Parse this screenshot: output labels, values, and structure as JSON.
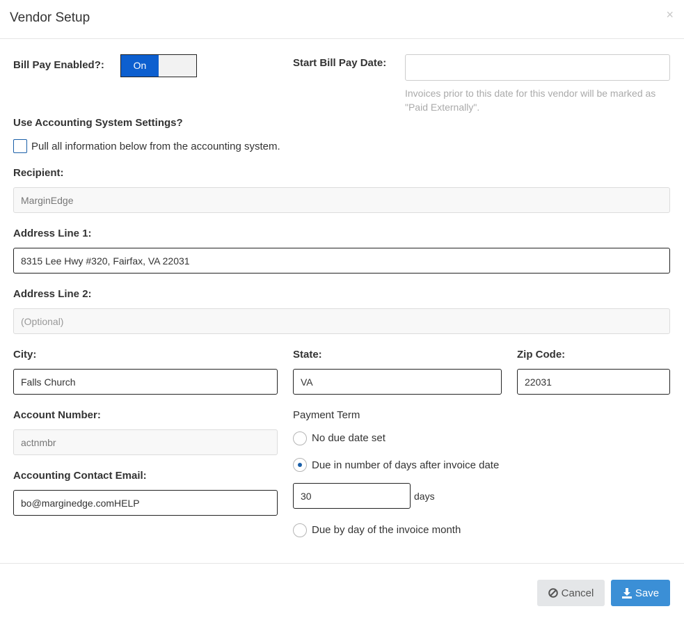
{
  "header": {
    "title": "Vendor Setup",
    "close_glyph": "×"
  },
  "bill_pay": {
    "label": "Bill Pay Enabled?:",
    "toggle_on_label": "On",
    "toggle_state": "on"
  },
  "start_date": {
    "label": "Start Bill Pay Date:",
    "value": "",
    "help": "Invoices prior to this date for this vendor will be marked as \"Paid Externally\"."
  },
  "accounting": {
    "label": "Use Accounting System Settings?",
    "checkbox_label": "Pull all information below from the accounting system.",
    "checked": false
  },
  "recipient": {
    "label": "Recipient:",
    "value": "MarginEdge"
  },
  "address1": {
    "label": "Address Line 1:",
    "value": "8315 Lee Hwy #320, Fairfax, VA 22031"
  },
  "address2": {
    "label": "Address Line 2:",
    "value": "",
    "placeholder": "(Optional)"
  },
  "city": {
    "label": "City:",
    "value": "Falls Church"
  },
  "state": {
    "label": "State:",
    "value": "VA"
  },
  "zip": {
    "label": "Zip Code:",
    "value": "22031"
  },
  "account_number": {
    "label": "Account Number:",
    "value": "actnmbr"
  },
  "contact_email": {
    "label": "Accounting Contact Email:",
    "value": "bo@marginedge.comHELP"
  },
  "payment_term": {
    "label": "Payment Term",
    "options": [
      {
        "label": "No due date set",
        "selected": false
      },
      {
        "label": "Due in number of days after invoice date",
        "selected": true
      },
      {
        "label": "Due by day of the invoice month",
        "selected": false
      }
    ],
    "days_value": "30",
    "days_unit": "days"
  },
  "footer": {
    "cancel_label": "Cancel",
    "save_label": "Save",
    "save_color": "#3b8fd6",
    "cancel_icon": "ban-icon",
    "save_icon": "download-icon"
  }
}
